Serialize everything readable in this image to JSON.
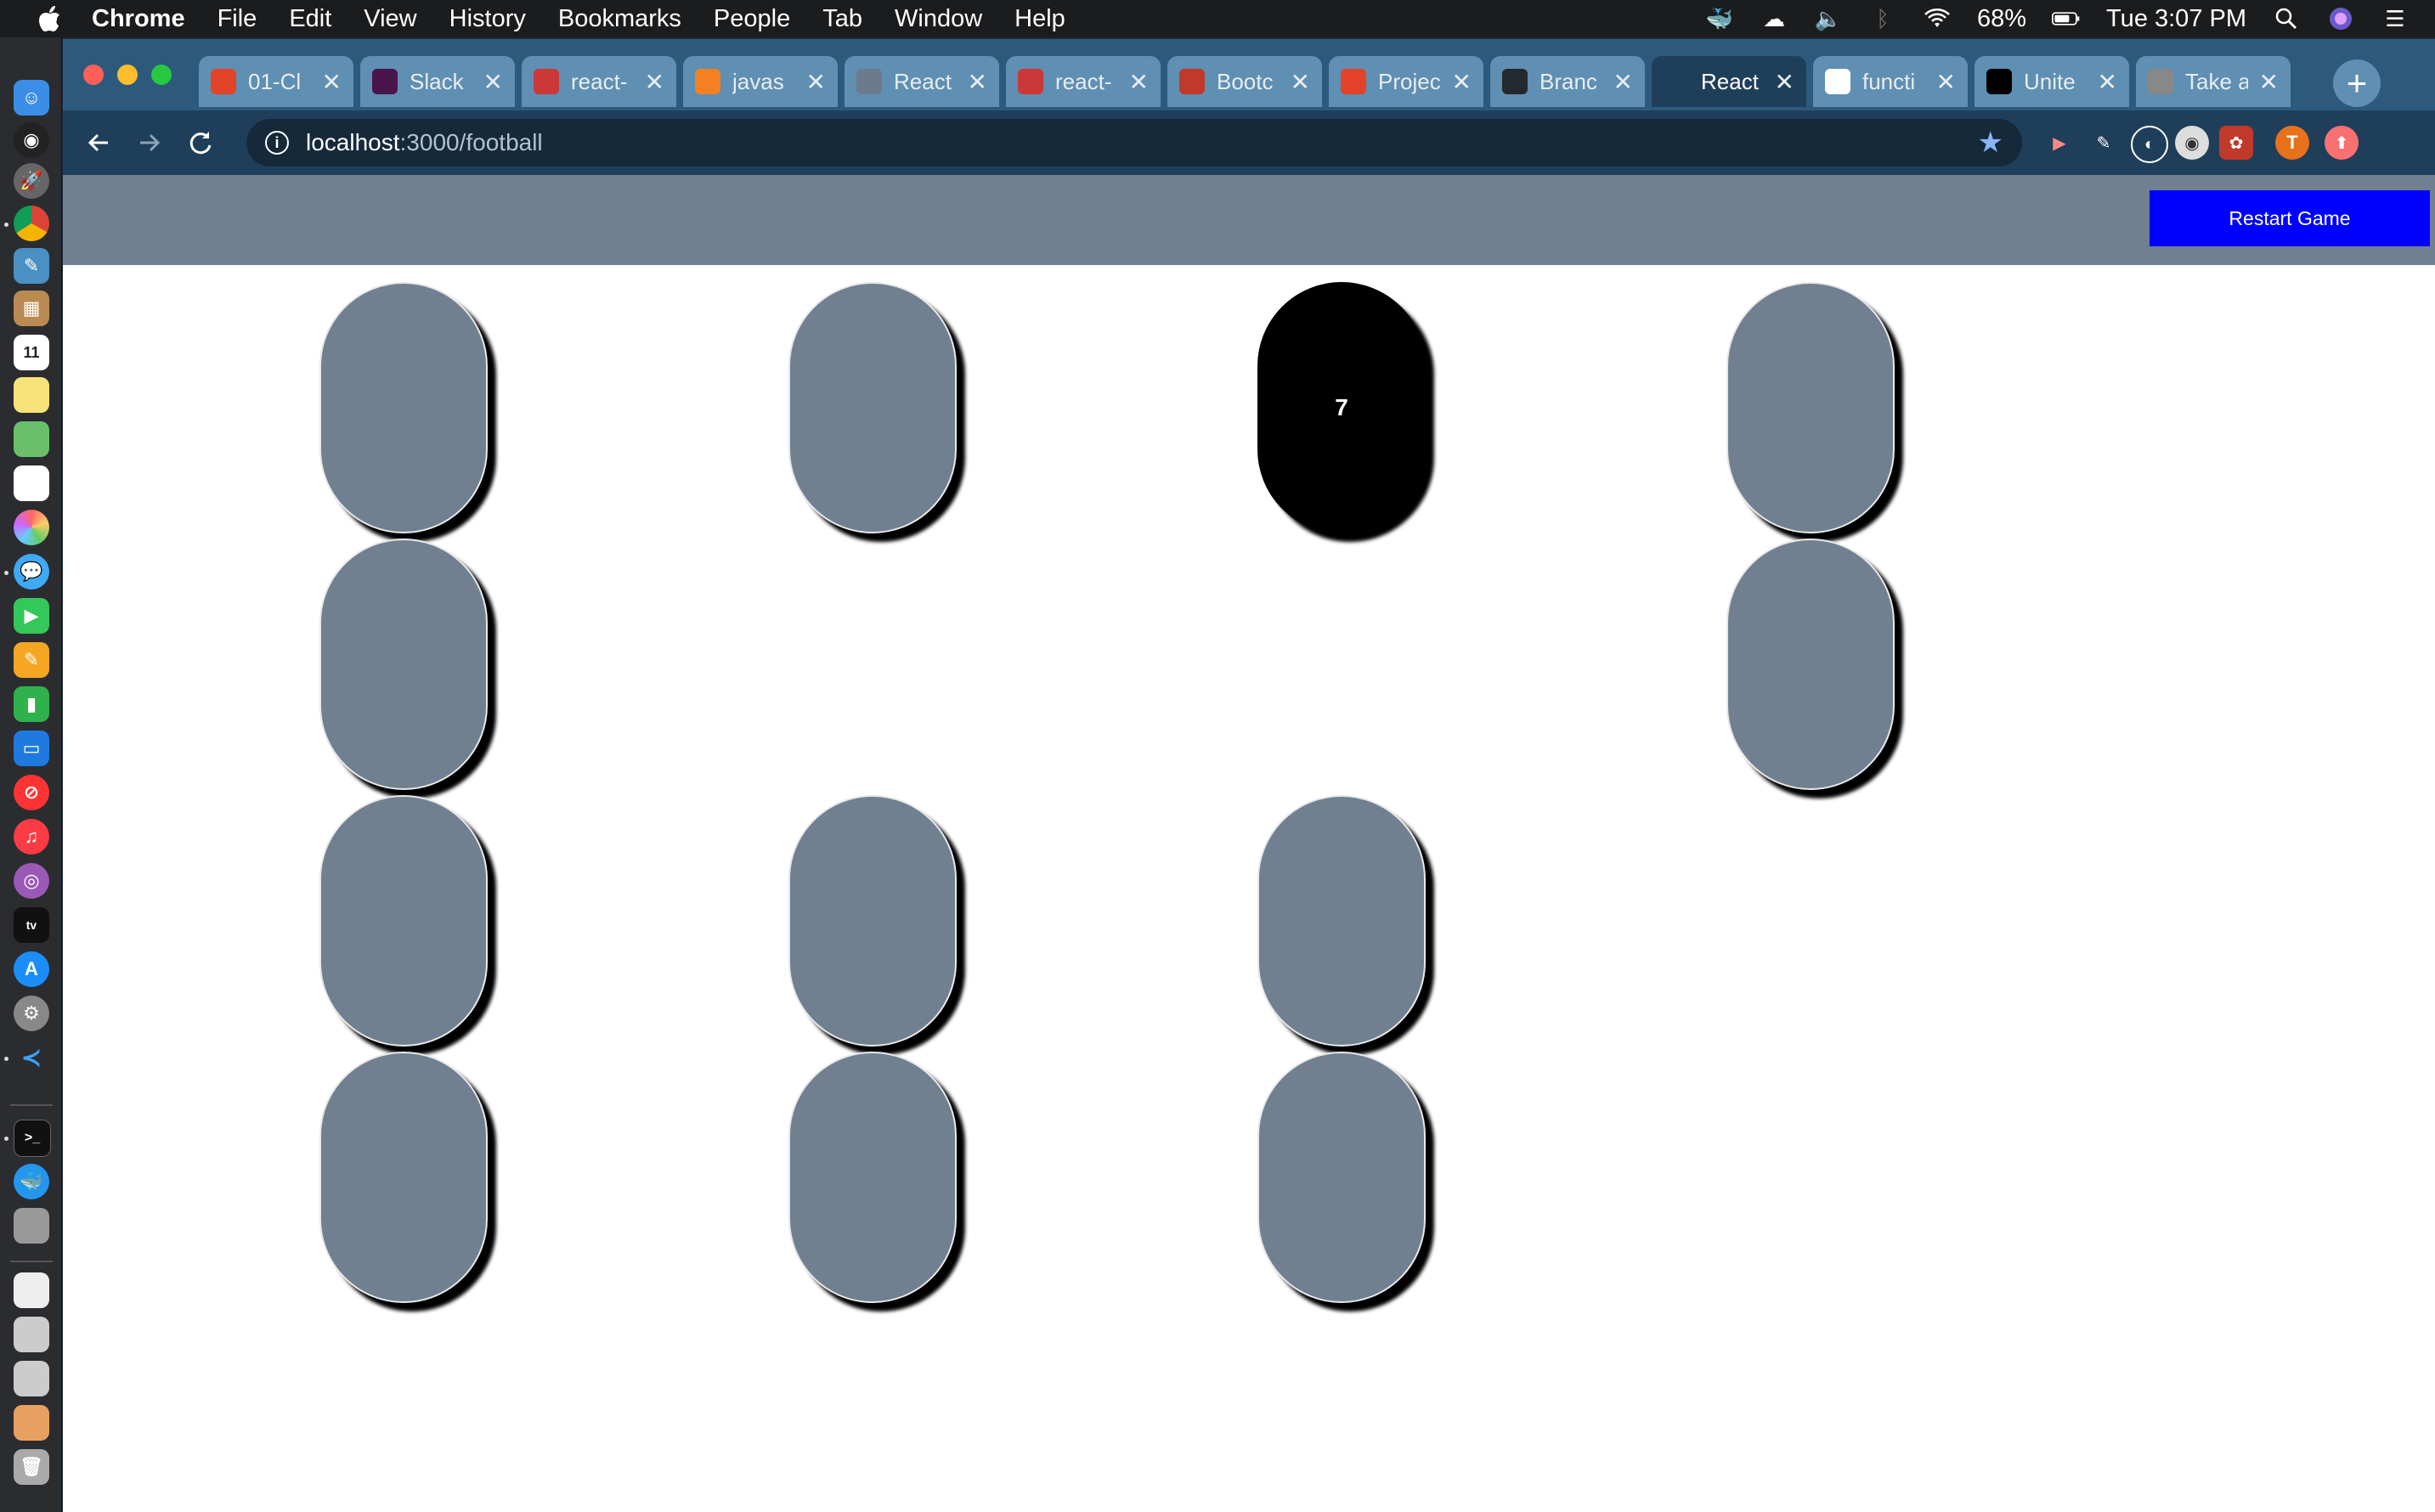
{
  "menubar": {
    "app_name": "Chrome",
    "items": [
      "File",
      "Edit",
      "View",
      "History",
      "Bookmarks",
      "People",
      "Tab",
      "Window",
      "Help"
    ],
    "battery": "68%",
    "clock": "Tue 3:07 PM"
  },
  "tabs": [
    {
      "title": "01-Cl",
      "icon": "gitlab-icon",
      "color": "#e24329"
    },
    {
      "title": "Slack",
      "icon": "slack-icon",
      "color": "#4a154b"
    },
    {
      "title": "react-",
      "icon": "npm-icon",
      "color": "#cb3837"
    },
    {
      "title": "javas",
      "icon": "stackoverflow-icon",
      "color": "#f48024"
    },
    {
      "title": "React",
      "icon": "globe-icon",
      "color": "#6b7b8c"
    },
    {
      "title": "react-",
      "icon": "npm-icon",
      "color": "#cb3837"
    },
    {
      "title": "Bootc",
      "icon": "bootcamp-icon",
      "color": "#c0392b"
    },
    {
      "title": "Projec",
      "icon": "gitlab-icon",
      "color": "#e24329"
    },
    {
      "title": "Branc",
      "icon": "github-icon",
      "color": "#24292e"
    },
    {
      "title": "React",
      "icon": "react-icon",
      "color": "#1f3e5a",
      "active": true
    },
    {
      "title": "functi",
      "icon": "google-icon",
      "color": "#ffffff"
    },
    {
      "title": "Unite",
      "icon": "nytimes-icon",
      "color": "#000000"
    },
    {
      "title": "Take a",
      "icon": "apple-icon",
      "color": "#888888"
    }
  ],
  "address_bar": {
    "host": "localhost",
    "path": ":3000/football"
  },
  "profile_initial": "T",
  "game": {
    "restart_label": "Restart Game",
    "cards": [
      {
        "row": 0,
        "col": 0,
        "state": "hidden",
        "value": ""
      },
      {
        "row": 0,
        "col": 1,
        "state": "hidden",
        "value": ""
      },
      {
        "row": 0,
        "col": 2,
        "state": "flipped",
        "value": "7"
      },
      {
        "row": 0,
        "col": 3,
        "state": "hidden",
        "value": ""
      },
      {
        "row": 1,
        "col": 0,
        "state": "hidden",
        "value": ""
      },
      {
        "row": 1,
        "col": 3,
        "state": "hidden",
        "value": ""
      },
      {
        "row": 2,
        "col": 0,
        "state": "hidden",
        "value": ""
      },
      {
        "row": 2,
        "col": 1,
        "state": "hidden",
        "value": ""
      },
      {
        "row": 2,
        "col": 2,
        "state": "hidden",
        "value": ""
      },
      {
        "row": 3,
        "col": 0,
        "state": "hidden",
        "value": ""
      },
      {
        "row": 3,
        "col": 1,
        "state": "hidden",
        "value": ""
      },
      {
        "row": 3,
        "col": 2,
        "state": "hidden",
        "value": ""
      }
    ]
  },
  "colors": {
    "header": "#708090",
    "card_back": "#708090",
    "card_flipped": "#000000",
    "restart_button": "#0000ff"
  }
}
